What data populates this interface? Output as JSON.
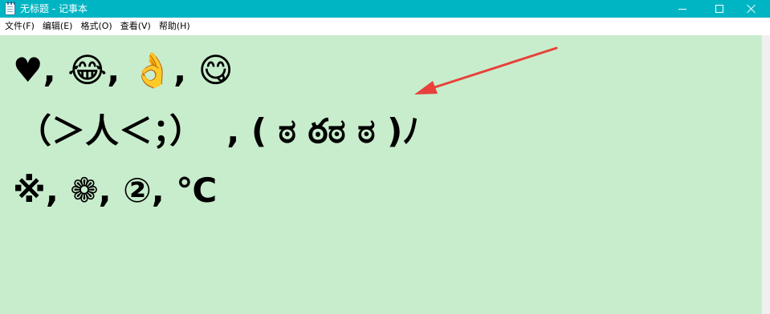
{
  "window": {
    "title": "无标题 - 记事本",
    "controls": {
      "minimize_icon": "minimize-icon",
      "maximize_icon": "maximize-icon",
      "close_icon": "close-icon"
    }
  },
  "menu": {
    "items": [
      "文件(F)",
      "编辑(E)",
      "格式(O)",
      "查看(V)",
      "帮助(H)"
    ]
  },
  "editor": {
    "lines": [
      "♥, 😂, 👌, 😋",
      "（＞人＜；）  , ( ಠ ఠಠ ಠ )ﾉ",
      "※, ❁, ②, ℃"
    ],
    "background": "#c8edcc"
  },
  "annotation": {
    "arrow_color": "#e8413b"
  },
  "colors": {
    "titlebar": "#00b5c3",
    "text": "#000000"
  }
}
